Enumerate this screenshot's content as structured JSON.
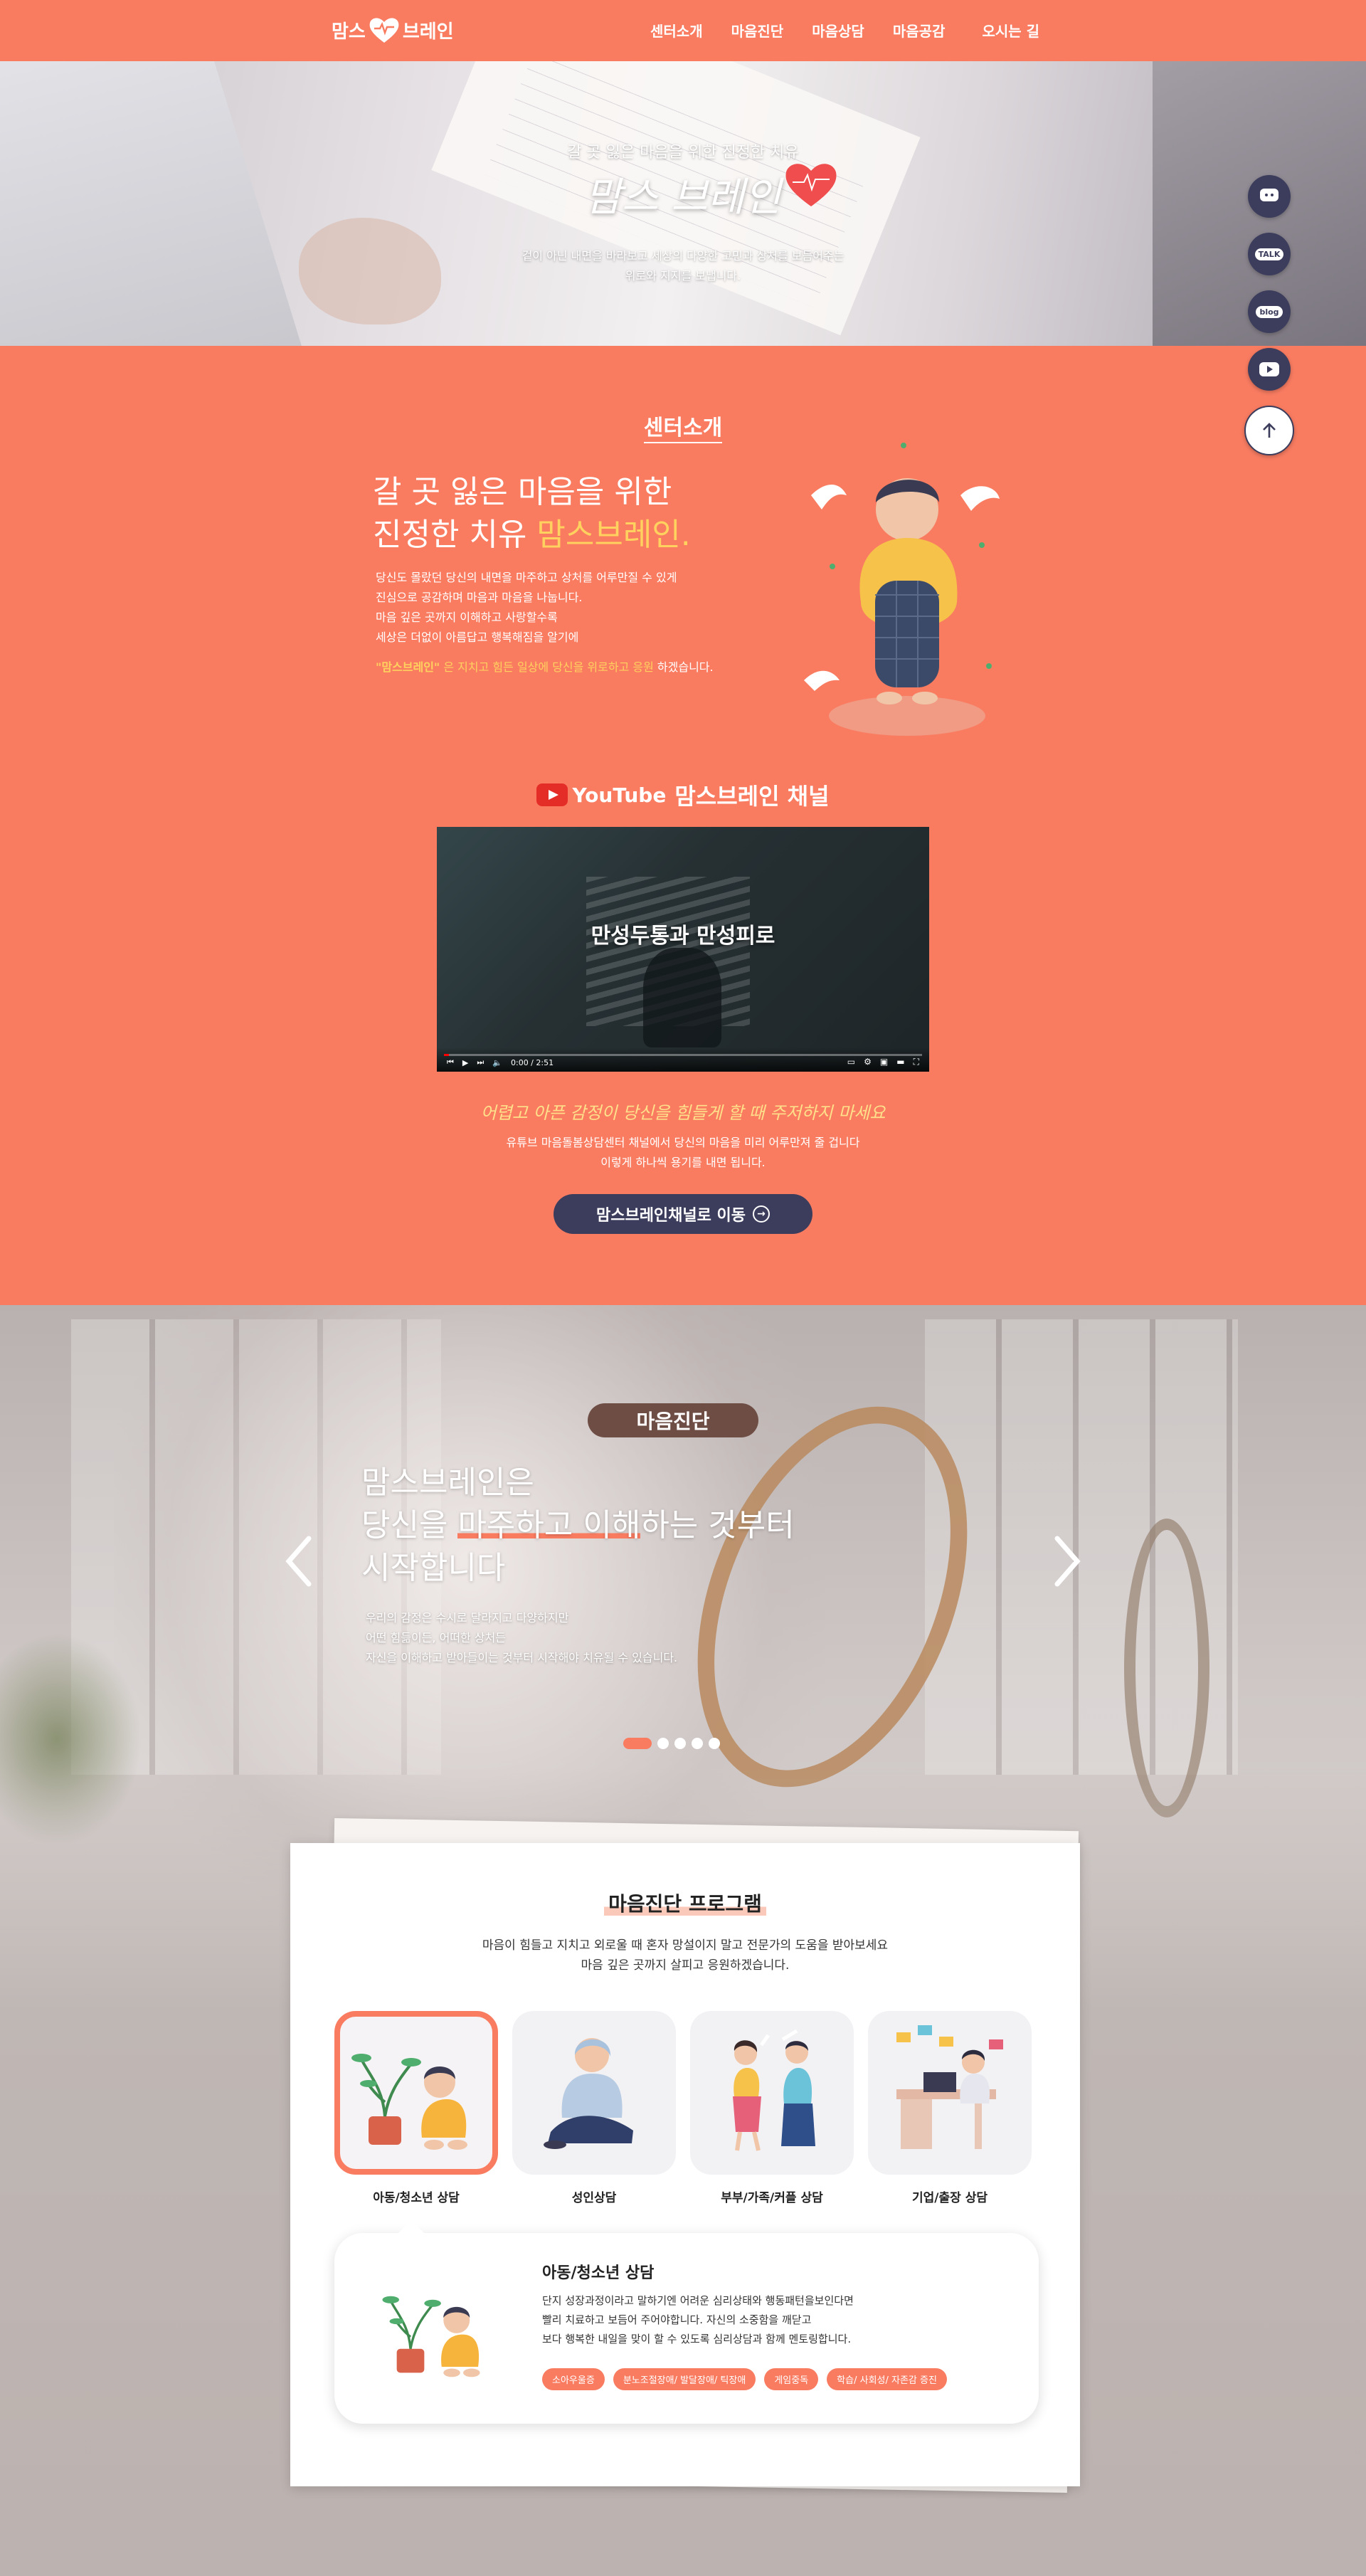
{
  "header": {
    "logo_text_left": "맘스",
    "logo_text_right": "브레인",
    "nav": [
      "센터소개",
      "마음진단",
      "마음상담",
      "마음공감",
      "오시는 길"
    ]
  },
  "hero": {
    "subtitle": "갈 곳 잃은 마음을 위한 진정한 치유",
    "title": "맘스 브레인",
    "desc_line1": "겉이 아닌 내면을 바라보고 세상의 다양한 고민과 상처를 보듬어주는",
    "desc_line2": "위로와 지지를 보냅니다."
  },
  "quick_menu": [
    {
      "icon": "chat-icon"
    },
    {
      "icon": "kakaotalk-icon",
      "label": "TALK"
    },
    {
      "icon": "blog-icon",
      "label": "blog"
    },
    {
      "icon": "youtube-icon"
    },
    {
      "icon": "arrow-up-icon"
    }
  ],
  "intro": {
    "section_title": "센터소개",
    "heading_line1": "갈 곳 잃은 마음을 위한",
    "heading_line2_prefix": "진정한 치유 ",
    "heading_line2_accent": "맘스브레인.",
    "paragraph": [
      "당신도 몰랐던 당신의 내면을 마주하고 상처를 어루만질 수 있게",
      "진심으로 공감하며 마음과 마음을 나눕니다.",
      "마음 깊은 곳까지 이해하고 사랑할수록",
      "세상은 더없이 아름답고 행복해짐을 알기에"
    ],
    "highlight_brand": "\"맘스브레인\"",
    "highlight_mid": " 은 지치고 힘든 일상에 당신을 위로하고 응원",
    "highlight_end": " 하겠습니다."
  },
  "youtube": {
    "logo_text": "YouTube",
    "channel_title": "맘스브레인 채널",
    "video_title": "만성두통과 만성피로",
    "video_time": "0:00 / 2:51",
    "quote": "어렵고 아픈 감정이 당신을 힘들게 할 때 주저하지 마세요",
    "desc_line1": "유튜브 마음돌봄상담센터 채널에서 당신의 마음을 미리 어루만져 줄 겁니다",
    "desc_line2": "이렇게 하나씩 용기를 내면 됩니다.",
    "button_label": "맘스브레인채널로 이동",
    "progress": 0.01
  },
  "diagnosis": {
    "badge": "마음진단",
    "heading_line1": "맘스브레인은",
    "heading_line2_pre": "당신을 ",
    "heading_line2_ul": "마주하고 이해",
    "heading_line2_post": "하는 것부터",
    "heading_line3": "시작합니다",
    "paragraph": [
      "우리의 감정은 수시로 달라지고 다양하지만",
      "어떤 힘듦이든, 어떠한 상처든",
      "자신을 이해하고 받아들이는 것부터 시작해야 치유될 수 있습니다."
    ],
    "slides_total": 5,
    "slide_active": 1
  },
  "program": {
    "title": "마음진단 프로그램",
    "desc_line1": "마음이 힘들고 지치고 외로울 때 혼자 망설이지 말고 전문가의 도움을 받아보세요",
    "desc_line2": "마음 깊은 곳까지 살피고 응원하겠습니다.",
    "items": [
      {
        "label": "아동/청소년 상담",
        "active": true
      },
      {
        "label": "성인상담",
        "active": false
      },
      {
        "label": "부부/가족/커플 상담",
        "active": false
      },
      {
        "label": "기업/출장 상담",
        "active": false
      }
    ],
    "detail": {
      "title": "아동/청소년 상담",
      "text": [
        "단지 성장과정이라고 말하기엔 어려운 심리상태와 행동패턴을보인다면",
        "빨리 치료하고 보듬어 주어야합니다. 자신의 소중함을 깨닫고",
        "보다 행복한 내일을 맞이 할 수 있도록 심리상담과 함께 멘토링합니다."
      ],
      "tags": [
        "소아우울증",
        "분노조절장애/ 발달장애/ 틱장애",
        "게임중독",
        "학습/ 사회성/ 자존감 증진"
      ]
    }
  },
  "colors": {
    "brand": "#f97c61",
    "navy": "#3c3d5c",
    "accent_yellow": "#ffd15e",
    "badge_brown": "#6e4d45"
  }
}
